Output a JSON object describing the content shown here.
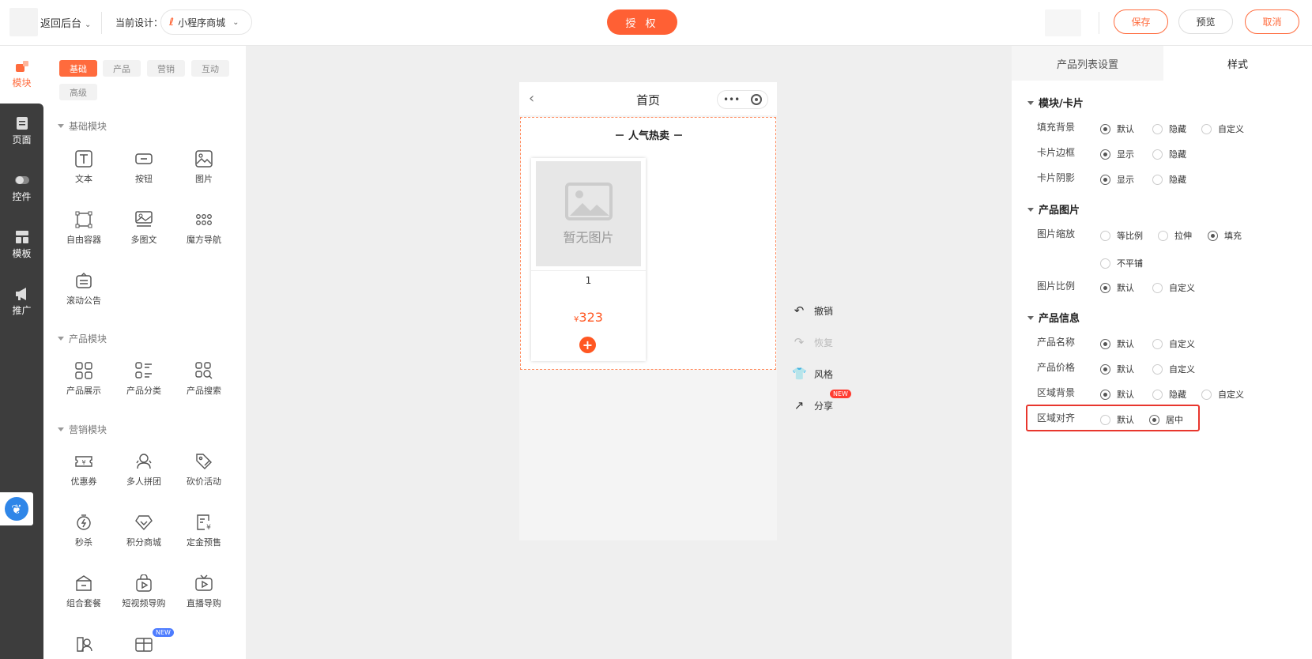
{
  "topbar": {
    "back_label": "返回后台",
    "current_design_label": "当前设计：",
    "design_select_value": "小程序商城",
    "authorize_label": "授 权",
    "save_label": "保存",
    "preview_label": "预览",
    "cancel_label": "取消"
  },
  "rail": {
    "items": [
      {
        "label": "模块",
        "icon": "module-icon",
        "active": true
      },
      {
        "label": "页面",
        "icon": "page-icon"
      },
      {
        "label": "控件",
        "icon": "toggle-icon"
      },
      {
        "label": "模板",
        "icon": "template-icon"
      },
      {
        "label": "推广",
        "icon": "megaphone-icon"
      }
    ]
  },
  "panel": {
    "tabs": [
      "基础",
      "产品",
      "营销",
      "互动",
      "高级"
    ],
    "sections": [
      {
        "title": "基础模块",
        "items": [
          "文本",
          "按钮",
          "图片",
          "自由容器",
          "多图文",
          "魔方导航",
          "滚动公告"
        ]
      },
      {
        "title": "产品模块",
        "items": [
          "产品展示",
          "产品分类",
          "产品搜索"
        ]
      },
      {
        "title": "营销模块",
        "items": [
          "优惠券",
          "多人拼团",
          "砍价活动",
          "秒杀",
          "积分商城",
          "定金预售",
          "组合套餐",
          "短视频导购",
          "直播导购"
        ]
      }
    ],
    "new_badge": "NEW"
  },
  "phone": {
    "title": "首页",
    "capsule_dots": "•••",
    "hot_title": "－ 人气热卖 －",
    "no_image_text": "暂无图片",
    "product_name": "1",
    "currency": "¥",
    "price": "323",
    "add_symbol": "+"
  },
  "actions": {
    "undo": "撤销",
    "redo": "恢复",
    "style": "风格",
    "share": "分享",
    "share_badge": "NEW"
  },
  "settings": {
    "tabs": [
      "产品列表设置",
      "样式"
    ],
    "groups": {
      "module_card": "模块/卡片",
      "product_image": "产品图片",
      "product_info": "产品信息"
    },
    "rows": {
      "fill_bg": {
        "label": "填充背景",
        "options": [
          "默认",
          "隐藏",
          "自定义"
        ],
        "selected": "默认"
      },
      "card_border": {
        "label": "卡片边框",
        "options": [
          "显示",
          "隐藏"
        ],
        "selected": "显示"
      },
      "card_shadow": {
        "label": "卡片阴影",
        "options": [
          "显示",
          "隐藏"
        ],
        "selected": "显示"
      },
      "img_scale": {
        "label": "图片缩放",
        "options": [
          "等比例",
          "拉伸",
          "填充",
          "不平铺"
        ],
        "selected": "填充"
      },
      "img_ratio": {
        "label": "图片比例",
        "options": [
          "默认",
          "自定义"
        ],
        "selected": "默认"
      },
      "prod_name": {
        "label": "产品名称",
        "options": [
          "默认",
          "自定义"
        ],
        "selected": "默认"
      },
      "prod_price": {
        "label": "产品价格",
        "options": [
          "默认",
          "自定义"
        ],
        "selected": "默认"
      },
      "area_bg": {
        "label": "区域背景",
        "options": [
          "默认",
          "隐藏",
          "自定义"
        ],
        "selected": "默认"
      },
      "area_align": {
        "label": "区域对齐",
        "options": [
          "默认",
          "居中"
        ],
        "selected": "居中"
      }
    }
  },
  "colors": {
    "accent": "#ff6b3d",
    "highlight": "#e8362d"
  }
}
